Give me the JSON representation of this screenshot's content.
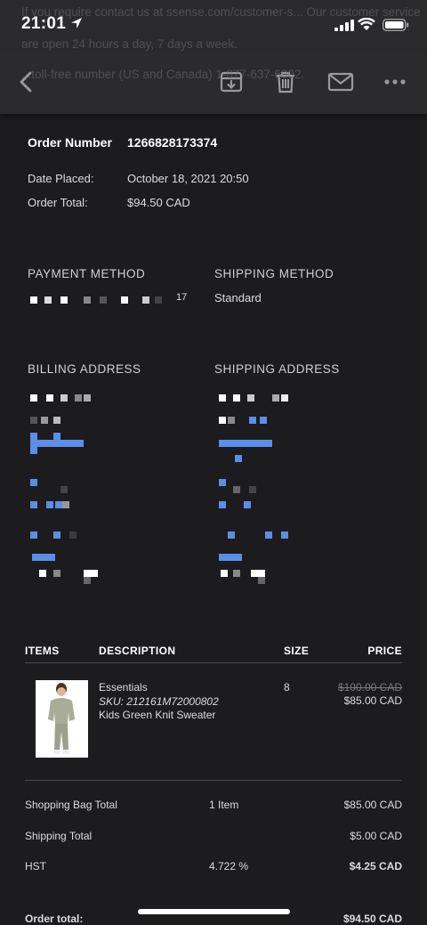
{
  "status": {
    "time": "21:01"
  },
  "ghost_text": {
    "line1": "If you require contact us at ssense.com/customer-s... Our customer service",
    "line2": "are open 24 hours a day, 7 days a week.",
    "line3": "...toll-free number (US and Canada) 1-877-637-6002."
  },
  "toolbar": {
    "back_icon": "chevron-left-icon",
    "archive_icon": "archive-icon",
    "trash_icon": "trash-icon",
    "mail_icon": "mail-icon",
    "more_icon": "more-icon"
  },
  "order": {
    "number_label": "Order Number",
    "number": "1266828173374",
    "date_label": "Date Placed:",
    "date": "October 18, 2021 20:50",
    "total_label": "Order Total:",
    "total": "$94.50 CAD"
  },
  "payment": {
    "heading": "PAYMENT METHOD",
    "suffix": "17"
  },
  "shipping_method": {
    "heading": "SHIPPING METHOD",
    "value": "Standard"
  },
  "billing": {
    "heading": "BILLING ADDRESS"
  },
  "shipping_address": {
    "heading": "SHIPPING ADDRESS"
  },
  "items_table": {
    "headers": {
      "items": "ITEMS",
      "description": "DESCRIPTION",
      "size": "SIZE",
      "price": "PRICE"
    },
    "rows": [
      {
        "brand": "Essentials",
        "sku": "SKU: 212161M72000802",
        "name": "Kids Green Knit Sweater",
        "size": "8",
        "original_price": "$100.00 CAD",
        "price": "$85.00 CAD"
      }
    ]
  },
  "summary": {
    "bag_label": "Shopping Bag Total",
    "bag_count": "1 Item",
    "bag_value": "$85.00 CAD",
    "shipping_label": "Shipping Total",
    "shipping_value": "$5.00 CAD",
    "tax_label": "HST",
    "tax_rate": "4.722 %",
    "tax_value": "$4.25 CAD",
    "order_total_label": "Order total:",
    "order_total_value": "$94.50 CAD"
  },
  "colors": {
    "background": "#1c1c1e",
    "toolbar": "#2b2b2d",
    "redaction_blue": "#5b8ee6"
  }
}
